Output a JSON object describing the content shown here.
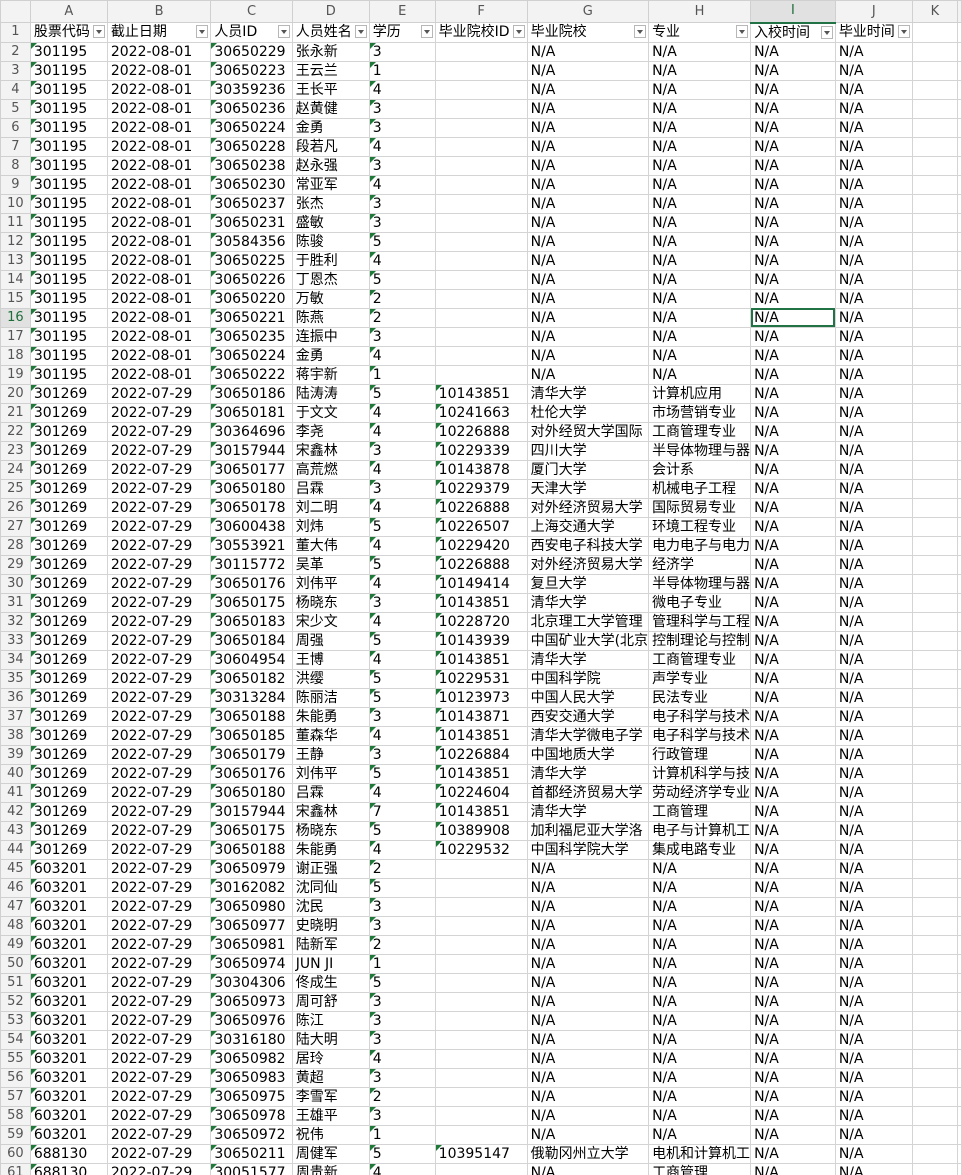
{
  "columns": [
    "A",
    "B",
    "C",
    "D",
    "E",
    "F",
    "G",
    "H",
    "I",
    "J",
    "K"
  ],
  "header": [
    "股票代码",
    "截止日期",
    "人员ID",
    "人员姓名",
    "学历",
    "毕业院校ID",
    "毕业院校",
    "专业",
    "入校时间",
    "毕业时间"
  ],
  "active_cell": "I16",
  "rows": [
    [
      "301195",
      "2022-08-01",
      "30650229",
      "张永新",
      "3",
      "",
      "N/A",
      "N/A",
      "N/A",
      "N/A"
    ],
    [
      "301195",
      "2022-08-01",
      "30650223",
      "王云兰",
      "1",
      "",
      "N/A",
      "N/A",
      "N/A",
      "N/A"
    ],
    [
      "301195",
      "2022-08-01",
      "30359236",
      "王长平",
      "4",
      "",
      "N/A",
      "N/A",
      "N/A",
      "N/A"
    ],
    [
      "301195",
      "2022-08-01",
      "30650236",
      "赵黄健",
      "3",
      "",
      "N/A",
      "N/A",
      "N/A",
      "N/A"
    ],
    [
      "301195",
      "2022-08-01",
      "30650224",
      "金勇",
      "3",
      "",
      "N/A",
      "N/A",
      "N/A",
      "N/A"
    ],
    [
      "301195",
      "2022-08-01",
      "30650228",
      "段若凡",
      "4",
      "",
      "N/A",
      "N/A",
      "N/A",
      "N/A"
    ],
    [
      "301195",
      "2022-08-01",
      "30650238",
      "赵永强",
      "3",
      "",
      "N/A",
      "N/A",
      "N/A",
      "N/A"
    ],
    [
      "301195",
      "2022-08-01",
      "30650230",
      "常亚军",
      "4",
      "",
      "N/A",
      "N/A",
      "N/A",
      "N/A"
    ],
    [
      "301195",
      "2022-08-01",
      "30650237",
      "张杰",
      "3",
      "",
      "N/A",
      "N/A",
      "N/A",
      "N/A"
    ],
    [
      "301195",
      "2022-08-01",
      "30650231",
      "盛敏",
      "3",
      "",
      "N/A",
      "N/A",
      "N/A",
      "N/A"
    ],
    [
      "301195",
      "2022-08-01",
      "30584356",
      "陈骏",
      "5",
      "",
      "N/A",
      "N/A",
      "N/A",
      "N/A"
    ],
    [
      "301195",
      "2022-08-01",
      "30650225",
      "于胜利",
      "4",
      "",
      "N/A",
      "N/A",
      "N/A",
      "N/A"
    ],
    [
      "301195",
      "2022-08-01",
      "30650226",
      "丁恩杰",
      "5",
      "",
      "N/A",
      "N/A",
      "N/A",
      "N/A"
    ],
    [
      "301195",
      "2022-08-01",
      "30650220",
      "万敏",
      "2",
      "",
      "N/A",
      "N/A",
      "N/A",
      "N/A"
    ],
    [
      "301195",
      "2022-08-01",
      "30650221",
      "陈燕",
      "2",
      "",
      "N/A",
      "N/A",
      "N/A",
      "N/A"
    ],
    [
      "301195",
      "2022-08-01",
      "30650235",
      "连振中",
      "3",
      "",
      "N/A",
      "N/A",
      "N/A",
      "N/A"
    ],
    [
      "301195",
      "2022-08-01",
      "30650224",
      "金勇",
      "4",
      "",
      "N/A",
      "N/A",
      "N/A",
      "N/A"
    ],
    [
      "301195",
      "2022-08-01",
      "30650222",
      "蒋宇新",
      "1",
      "",
      "N/A",
      "N/A",
      "N/A",
      "N/A"
    ],
    [
      "301269",
      "2022-07-29",
      "30650186",
      "陆涛涛",
      "5",
      "10143851",
      "清华大学",
      "计算机应用",
      "N/A",
      "N/A"
    ],
    [
      "301269",
      "2022-07-29",
      "30650181",
      "于文文",
      "4",
      "10241663",
      "杜伦大学",
      "市场营销专业",
      "N/A",
      "N/A"
    ],
    [
      "301269",
      "2022-07-29",
      "30364696",
      "李尧",
      "4",
      "10226888",
      "对外经贸大学国际",
      "工商管理专业",
      "N/A",
      "N/A"
    ],
    [
      "301269",
      "2022-07-29",
      "30157944",
      "宋鑫林",
      "3",
      "10229339",
      "四川大学",
      "半导体物理与器",
      "N/A",
      "N/A"
    ],
    [
      "301269",
      "2022-07-29",
      "30650177",
      "高荒燃",
      "4",
      "10143878",
      "厦门大学",
      "会计系",
      "N/A",
      "N/A"
    ],
    [
      "301269",
      "2022-07-29",
      "30650180",
      "吕霖",
      "3",
      "10229379",
      "天津大学",
      "机械电子工程",
      "N/A",
      "N/A"
    ],
    [
      "301269",
      "2022-07-29",
      "30650178",
      "刘二明",
      "4",
      "10226888",
      "对外经济贸易大学",
      "国际贸易专业",
      "N/A",
      "N/A"
    ],
    [
      "301269",
      "2022-07-29",
      "30600438",
      "刘炜",
      "5",
      "10226507",
      "上海交通大学",
      "环境工程专业",
      "N/A",
      "N/A"
    ],
    [
      "301269",
      "2022-07-29",
      "30553921",
      "董大伟",
      "4",
      "10229420",
      "西安电子科技大学",
      "电力电子与电力",
      "N/A",
      "N/A"
    ],
    [
      "301269",
      "2022-07-29",
      "30115772",
      "吴革",
      "5",
      "10226888",
      "对外经济贸易大学",
      "经济学",
      "N/A",
      "N/A"
    ],
    [
      "301269",
      "2022-07-29",
      "30650176",
      "刘伟平",
      "4",
      "10149414",
      "复旦大学",
      "半导体物理与器",
      "N/A",
      "N/A"
    ],
    [
      "301269",
      "2022-07-29",
      "30650175",
      "杨晓东",
      "3",
      "10143851",
      "清华大学",
      "微电子专业",
      "N/A",
      "N/A"
    ],
    [
      "301269",
      "2022-07-29",
      "30650183",
      "宋少文",
      "4",
      "10228720",
      "北京理工大学管理",
      "管理科学与工程",
      "N/A",
      "N/A"
    ],
    [
      "301269",
      "2022-07-29",
      "30650184",
      "周强",
      "5",
      "10143939",
      "中国矿业大学(北京",
      "控制理论与控制",
      "N/A",
      "N/A"
    ],
    [
      "301269",
      "2022-07-29",
      "30604954",
      "王博",
      "4",
      "10143851",
      "清华大学",
      "工商管理专业",
      "N/A",
      "N/A"
    ],
    [
      "301269",
      "2022-07-29",
      "30650182",
      "洪缨",
      "5",
      "10229531",
      "中国科学院",
      "声学专业",
      "N/A",
      "N/A"
    ],
    [
      "301269",
      "2022-07-29",
      "30313284",
      "陈丽洁",
      "5",
      "10123973",
      "中国人民大学",
      "民法专业",
      "N/A",
      "N/A"
    ],
    [
      "301269",
      "2022-07-29",
      "30650188",
      "朱能勇",
      "3",
      "10143871",
      "西安交通大学",
      "电子科学与技术",
      "N/A",
      "N/A"
    ],
    [
      "301269",
      "2022-07-29",
      "30650185",
      "董森华",
      "4",
      "10143851",
      "清华大学微电子学",
      "电子科学与技术",
      "N/A",
      "N/A"
    ],
    [
      "301269",
      "2022-07-29",
      "30650179",
      "王静",
      "3",
      "10226884",
      "中国地质大学",
      "行政管理",
      "N/A",
      "N/A"
    ],
    [
      "301269",
      "2022-07-29",
      "30650176",
      "刘伟平",
      "5",
      "10143851",
      "清华大学",
      "计算机科学与技",
      "N/A",
      "N/A"
    ],
    [
      "301269",
      "2022-07-29",
      "30650180",
      "吕霖",
      "4",
      "10224604",
      "首都经济贸易大学",
      "劳动经济学专业",
      "N/A",
      "N/A"
    ],
    [
      "301269",
      "2022-07-29",
      "30157944",
      "宋鑫林",
      "7",
      "10143851",
      "清华大学",
      "工商管理",
      "N/A",
      "N/A"
    ],
    [
      "301269",
      "2022-07-29",
      "30650175",
      "杨晓东",
      "5",
      "10389908",
      "加利福尼亚大学洛",
      "电子与计算机工",
      "N/A",
      "N/A"
    ],
    [
      "301269",
      "2022-07-29",
      "30650188",
      "朱能勇",
      "4",
      "10229532",
      "中国科学院大学",
      "集成电路专业",
      "N/A",
      "N/A"
    ],
    [
      "603201",
      "2022-07-29",
      "30650979",
      "谢正强",
      "2",
      "",
      "N/A",
      "N/A",
      "N/A",
      "N/A"
    ],
    [
      "603201",
      "2022-07-29",
      "30162082",
      "沈同仙",
      "5",
      "",
      "N/A",
      "N/A",
      "N/A",
      "N/A"
    ],
    [
      "603201",
      "2022-07-29",
      "30650980",
      "沈民",
      "3",
      "",
      "N/A",
      "N/A",
      "N/A",
      "N/A"
    ],
    [
      "603201",
      "2022-07-29",
      "30650977",
      "史晓明",
      "3",
      "",
      "N/A",
      "N/A",
      "N/A",
      "N/A"
    ],
    [
      "603201",
      "2022-07-29",
      "30650981",
      "陆新军",
      "2",
      "",
      "N/A",
      "N/A",
      "N/A",
      "N/A"
    ],
    [
      "603201",
      "2022-07-29",
      "30650974",
      "JUN JI",
      "1",
      "",
      "N/A",
      "N/A",
      "N/A",
      "N/A"
    ],
    [
      "603201",
      "2022-07-29",
      "30304306",
      "佟成生",
      "5",
      "",
      "N/A",
      "N/A",
      "N/A",
      "N/A"
    ],
    [
      "603201",
      "2022-07-29",
      "30650973",
      "周可舒",
      "3",
      "",
      "N/A",
      "N/A",
      "N/A",
      "N/A"
    ],
    [
      "603201",
      "2022-07-29",
      "30650976",
      "陈江",
      "3",
      "",
      "N/A",
      "N/A",
      "N/A",
      "N/A"
    ],
    [
      "603201",
      "2022-07-29",
      "30316180",
      "陆大明",
      "3",
      "",
      "N/A",
      "N/A",
      "N/A",
      "N/A"
    ],
    [
      "603201",
      "2022-07-29",
      "30650982",
      "居玲",
      "4",
      "",
      "N/A",
      "N/A",
      "N/A",
      "N/A"
    ],
    [
      "603201",
      "2022-07-29",
      "30650983",
      "黄超",
      "3",
      "",
      "N/A",
      "N/A",
      "N/A",
      "N/A"
    ],
    [
      "603201",
      "2022-07-29",
      "30650975",
      "李雪军",
      "2",
      "",
      "N/A",
      "N/A",
      "N/A",
      "N/A"
    ],
    [
      "603201",
      "2022-07-29",
      "30650978",
      "王雄平",
      "3",
      "",
      "N/A",
      "N/A",
      "N/A",
      "N/A"
    ],
    [
      "603201",
      "2022-07-29",
      "30650972",
      "祝伟",
      "1",
      "",
      "N/A",
      "N/A",
      "N/A",
      "N/A"
    ],
    [
      "688130",
      "2022-07-29",
      "30650211",
      "周健军",
      "5",
      "10395147",
      "俄勒冈州立大学",
      "电机和计算机工",
      "N/A",
      "N/A"
    ],
    [
      "688130",
      "2022-07-29",
      "30051577",
      "周贵新",
      "4",
      "",
      "N/A",
      "工商管理",
      "N/A",
      "N/A"
    ]
  ]
}
